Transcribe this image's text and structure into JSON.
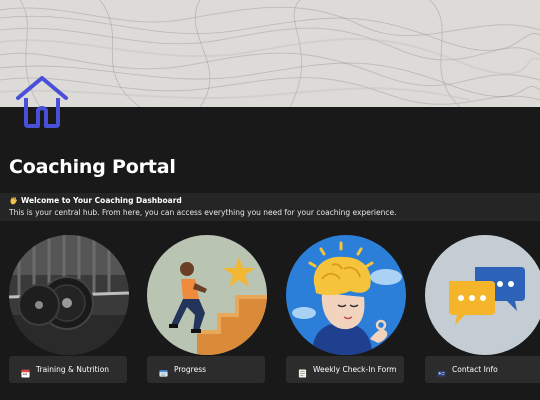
{
  "page": {
    "title": "Coaching Portal",
    "background": "#191919"
  },
  "icons": {
    "page_icon": "home-icon",
    "accent": "#4a4fd8"
  },
  "callout": {
    "emoji": "waving-hand-icon",
    "title": "Welcome to Your Coaching Dashboard",
    "body": "This is your central hub. From here, you can access everything you need for your coaching experience."
  },
  "cards": [
    {
      "label": "Training & Nutrition",
      "icon": "calendar-icon",
      "image": "barbell-image"
    },
    {
      "label": "Progress",
      "icon": "card-index-icon",
      "image": "stairs-climber-image"
    },
    {
      "label": "Weekly Check-In Form",
      "icon": "memo-icon",
      "image": "brain-meditation-image"
    },
    {
      "label": "Contact Info",
      "icon": "contact-card-icon",
      "image": "chat-bubbles-image"
    }
  ]
}
